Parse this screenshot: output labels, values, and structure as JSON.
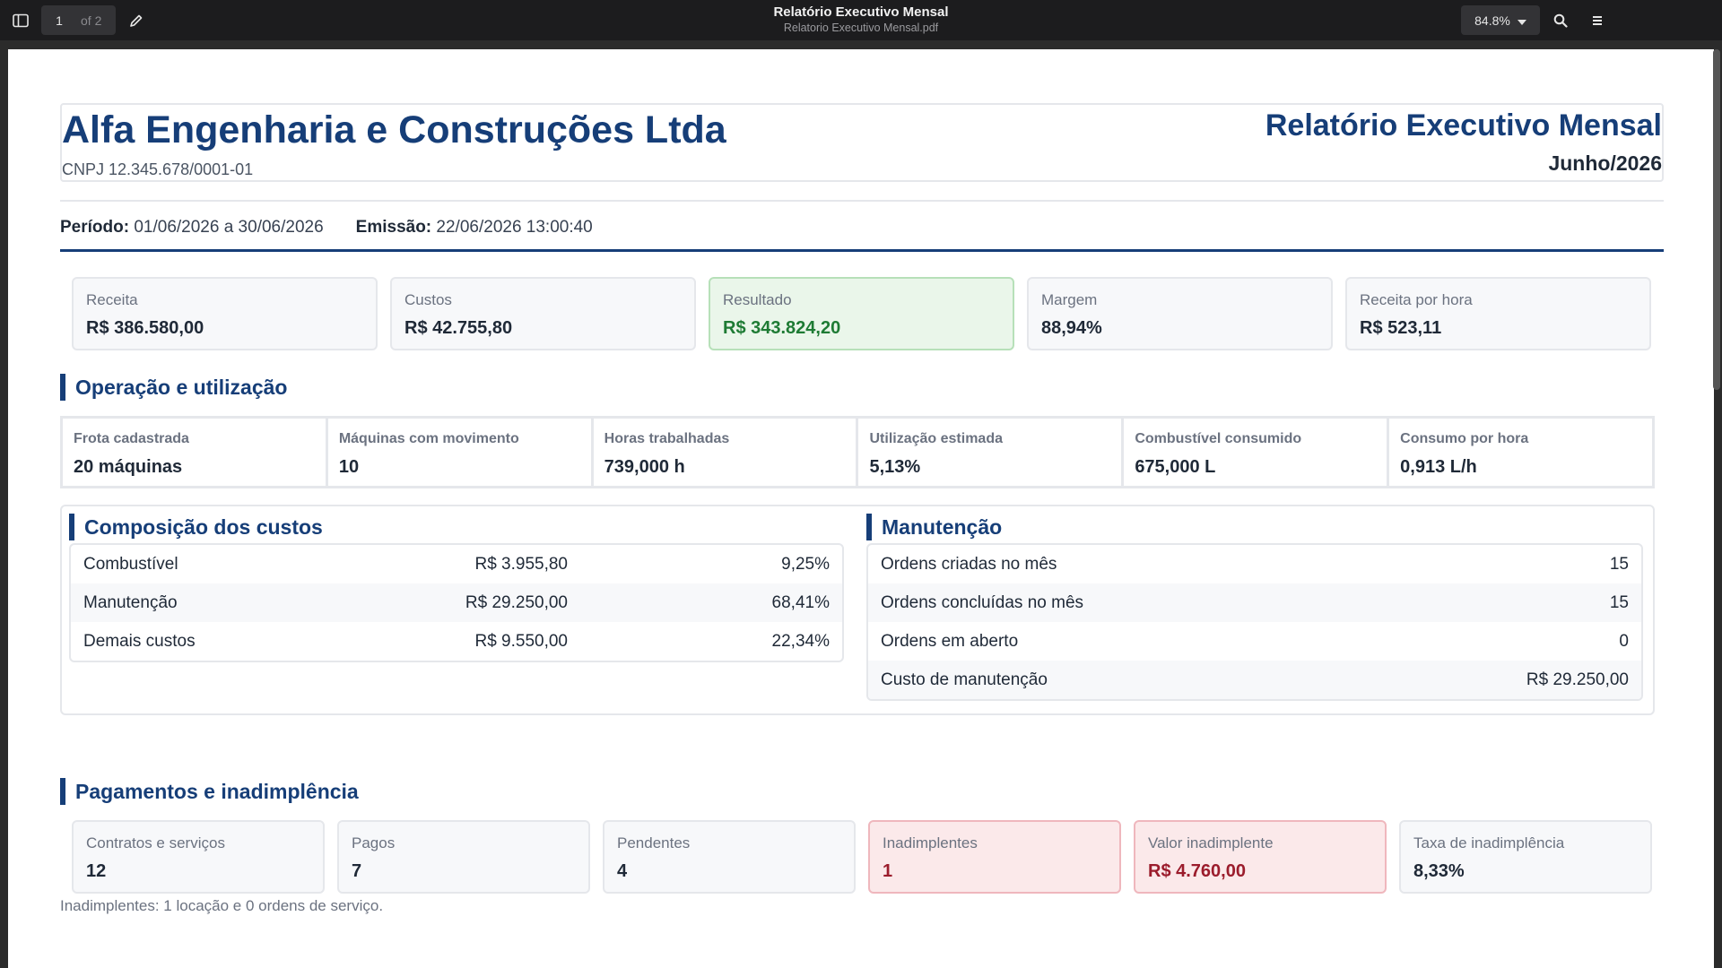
{
  "viewer": {
    "page_current": "1",
    "page_total": "of 2",
    "title": "Relatório Executivo Mensal",
    "filename": "Relatorio Executivo Mensal.pdf",
    "zoom": "84.8%"
  },
  "header": {
    "company": "Alfa Engenharia e Construções Ltda",
    "cnpj": "CNPJ 12.345.678/0001-01",
    "report_title": "Relatório Executivo Mensal",
    "month": "Junho/2026"
  },
  "meta": {
    "period_label": "Período:",
    "period_value": "01/06/2026 a 30/06/2026",
    "issued_label": "Emissão:",
    "issued_value": "22/06/2026 13:00:40"
  },
  "kpis": [
    {
      "label": "Receita",
      "value": "R$ 386.580,00"
    },
    {
      "label": "Custos",
      "value": "R$ 42.755,80"
    },
    {
      "label": "Resultado",
      "value": "R$ 343.824,20"
    },
    {
      "label": "Margem",
      "value": "88,94%"
    },
    {
      "label": "Receita por hora",
      "value": "R$ 523,11"
    }
  ],
  "operation": {
    "title": "Operação e utilização",
    "items": [
      {
        "label": "Frota cadastrada",
        "value": "20 máquinas"
      },
      {
        "label": "Máquinas com movimento",
        "value": "10"
      },
      {
        "label": "Horas trabalhadas",
        "value": "739,000 h"
      },
      {
        "label": "Utilização estimada",
        "value": "5,13%"
      },
      {
        "label": "Combustível consumido",
        "value": "675,000 L"
      },
      {
        "label": "Consumo por hora",
        "value": "0,913 L/h"
      }
    ]
  },
  "costs": {
    "title": "Composição dos custos",
    "rows": [
      {
        "name": "Combustível",
        "value": "R$ 3.955,80",
        "pct": "9,25%"
      },
      {
        "name": "Manutenção",
        "value": "R$ 29.250,00",
        "pct": "68,41%"
      },
      {
        "name": "Demais custos",
        "value": "R$ 9.550,00",
        "pct": "22,34%"
      }
    ]
  },
  "maintenance": {
    "title": "Manutenção",
    "rows": [
      {
        "name": "Ordens criadas no mês",
        "value": "15"
      },
      {
        "name": "Ordens concluídas no mês",
        "value": "15"
      },
      {
        "name": "Ordens em aberto",
        "value": "0"
      },
      {
        "name": "Custo de manutenção",
        "value": "R$ 29.250,00"
      }
    ]
  },
  "payments": {
    "title": "Pagamentos e inadimplência",
    "items": [
      {
        "label": "Contratos e serviços",
        "value": "12"
      },
      {
        "label": "Pagos",
        "value": "7"
      },
      {
        "label": "Pendentes",
        "value": "4"
      },
      {
        "label": "Inadimplentes",
        "value": "1"
      },
      {
        "label": "Valor inadimplente",
        "value": "R$ 4.760,00"
      },
      {
        "label": "Taxa de inadimplência",
        "value": "8,33%"
      }
    ],
    "footnote": "Inadimplentes: 1 locação e 0 ordens de serviço."
  }
}
